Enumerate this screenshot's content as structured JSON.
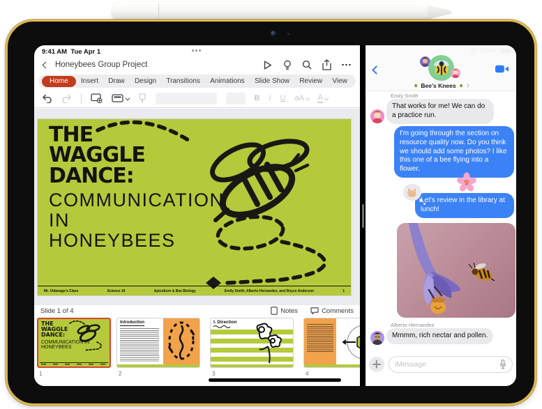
{
  "status": {
    "time": "9:41 AM",
    "date": "Tue Apr 1",
    "battery_percent": "100%"
  },
  "keynote": {
    "doc_title": "Honeybees Group Project",
    "tabs": [
      "Home",
      "Insert",
      "Draw",
      "Design",
      "Transitions",
      "Animations",
      "Slide Show",
      "Review",
      "View"
    ],
    "toolbar": {
      "bold": "B",
      "italic": "I",
      "underline": "U",
      "text_style": "aA",
      "text_color": "A"
    },
    "slide": {
      "title": "THE\nWAGGLE\nDANCE:",
      "subtitle": "COMMUNICATION\nIN\nHONEYBEES",
      "footer_class": "Mr. Vidanage's Class",
      "footer_subject": "Science 10",
      "footer_topic": "Apiculture & Bee Biology",
      "footer_authors": "Emily Smith, Alberto Hernandez, and Royce Anderson",
      "footer_page": "1"
    },
    "status_bar": {
      "slide_position": "Slide 1 of 4",
      "notes_label": "Notes",
      "comments_label": "Comments"
    },
    "thumbnails": [
      {
        "number": "1",
        "title": "THE WAGGLE DANCE:",
        "subtitle": "COMMUNICATION IN HONEYBEES"
      },
      {
        "number": "2",
        "title": "Introduction"
      },
      {
        "number": "3",
        "title": "I. Direction"
      },
      {
        "number": "4"
      }
    ]
  },
  "messages": {
    "group_name": "Bee's Knees",
    "chat": [
      {
        "sender": "Emily Smith",
        "direction": "received",
        "text": "That works for me! We can do a practice run."
      },
      {
        "direction": "sent",
        "text": "I'm going through the section on resource quality now. Do you think we should add some photos? I like this one of a bee flying into a flower.",
        "sticker": "cherry-blossom-emoji"
      },
      {
        "direction": "sent",
        "text": "Let's review in the library at lunch!",
        "reaction": "love-you-gesture-emoji"
      },
      {
        "direction": "sent",
        "type": "photo",
        "photo_alt": "bee flying toward purple flower, honey pot sticker"
      },
      {
        "sender": "Alberto Hernandez",
        "direction": "received",
        "text": "Mmmm, rich nectar and pollen."
      }
    ],
    "composer": {
      "placeholder": "iMessage"
    }
  }
}
